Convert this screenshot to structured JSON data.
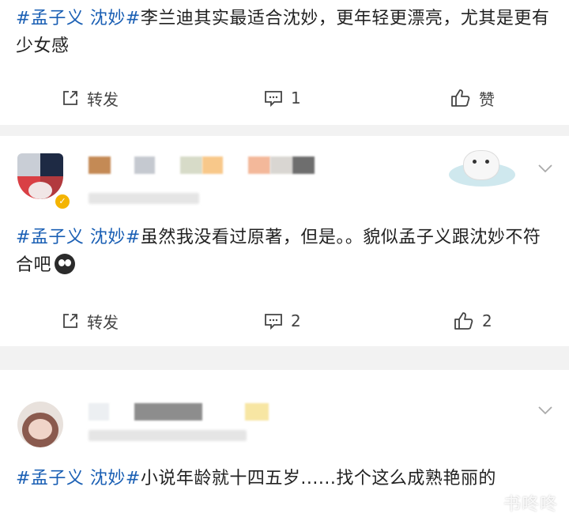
{
  "posts": [
    {
      "tag": "#孟子义 沈妙#",
      "body": "李兰迪其实最适合沈妙，更年轻更漂亮，尤其是更有少女感",
      "repost_label": "转发",
      "comment_count": "1",
      "like_label": "赞"
    },
    {
      "tag": "#孟子义 沈妙#",
      "body": "虽然我没看过原著，但是。。貌似孟子义跟沈妙不符合吧",
      "repost_label": "转发",
      "comment_count": "2",
      "like_count": "2",
      "verified": true
    },
    {
      "tag": "#孟子义 沈妙#",
      "body": "小说年龄就十四五岁......找个这么成熟艳丽的"
    }
  ],
  "watermark": "书咚咚",
  "colors": {
    "tag": "#1a5fb4",
    "divider": "#f2f2f2",
    "badge": "#f4b400"
  }
}
